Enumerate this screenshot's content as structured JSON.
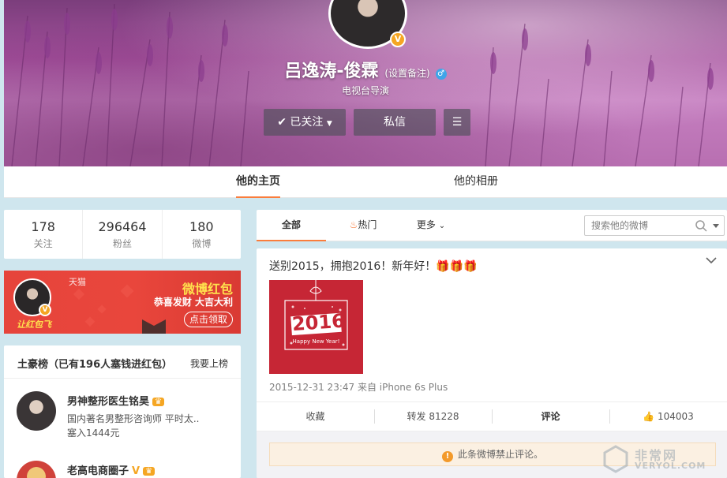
{
  "profile": {
    "name": "吕逸涛-俊霖",
    "remark_link": "(设置备注)",
    "subtitle": "电视台导演",
    "follow_button": "已关注",
    "message_button": "私信"
  },
  "nav": {
    "tabs": [
      {
        "label": "他的主页"
      },
      {
        "label": "他的相册"
      }
    ]
  },
  "stats": [
    {
      "value": "178",
      "label": "关注"
    },
    {
      "value": "296464",
      "label": "粉丝"
    },
    {
      "value": "180",
      "label": "微博"
    }
  ],
  "redpacket": {
    "title": "微博红包",
    "subtitle": "恭喜发财 大吉大利",
    "button": "点击领取",
    "tmall": "天猫",
    "tag": "让红包飞"
  },
  "rich_list": {
    "title": "土豪榜（已有196人塞钱进红包）",
    "link": "我要上榜",
    "items": [
      {
        "name": "男神整形医生铭昊",
        "desc": "国内著名男整形咨询师 平时太..",
        "amount": "塞入1444元"
      },
      {
        "name": "老高电商圈子",
        "desc": "",
        "amount": ""
      }
    ]
  },
  "feed": {
    "tabs": [
      {
        "label": "全部"
      },
      {
        "label": "热门"
      },
      {
        "label": "更多"
      }
    ],
    "search_placeholder": "搜索他的微博"
  },
  "post": {
    "text": "送别2015，拥抱2016！新年好！🎁🎁🎁",
    "image_year": "2016",
    "image_caption": "Happy New Year!",
    "meta": "2015-12-31 23:47 来自 iPhone 6s Plus",
    "actions": [
      {
        "label": "收藏"
      },
      {
        "label": "转发 81228"
      },
      {
        "label": "评论"
      },
      {
        "label": "104003"
      }
    ],
    "notice": "此条微博禁止评论。"
  },
  "watermark": {
    "cn": "非常网",
    "en": "VERYOL.COM"
  },
  "colors": {
    "accent": "#fa7d3c",
    "vip_gold": "#f5a623",
    "banner": "#a24f9b"
  }
}
